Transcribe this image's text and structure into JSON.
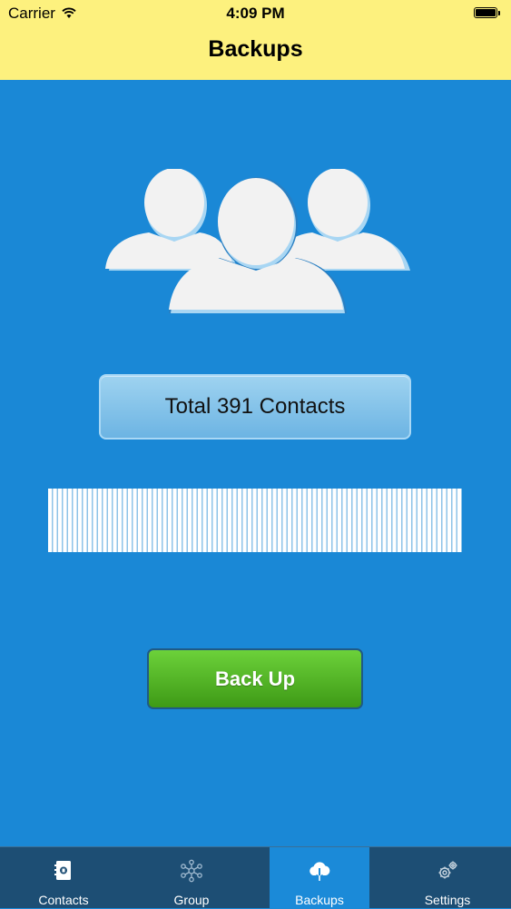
{
  "status_bar": {
    "carrier": "Carrier",
    "time": "4:09 PM"
  },
  "header": {
    "title": "Backups"
  },
  "main": {
    "icon": "group-users-icon",
    "contact_count_label": "Total 391 Contacts",
    "progress_icon": "striped-progress-bar",
    "backup_button_label": "Back Up"
  },
  "tabbar": {
    "items": [
      {
        "label": "Contacts",
        "icon": "contacts-book-icon",
        "active": false
      },
      {
        "label": "Group",
        "icon": "network-group-icon",
        "active": false
      },
      {
        "label": "Backups",
        "icon": "cloud-download-icon",
        "active": true
      },
      {
        "label": "Settings",
        "icon": "gears-icon",
        "active": false
      }
    ]
  },
  "colors": {
    "header_bg": "#fdf17e",
    "main_bg": "#1a88d6",
    "tabbar_bg": "#1d4e74",
    "button_green": "#52b626"
  }
}
